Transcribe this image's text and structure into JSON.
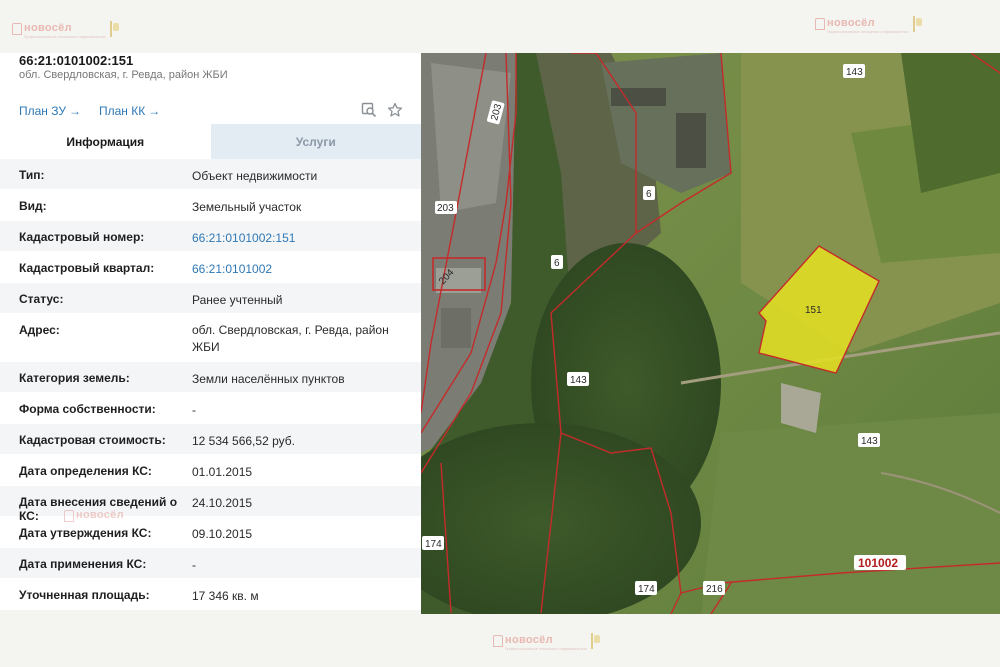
{
  "watermark": {
    "word": "новосёл",
    "sub": "Профессиональные отношения с недвижимостью"
  },
  "object": {
    "title": "66:21:0101002:151",
    "address": "обл. Свердловская, г. Ревда, район ЖБИ"
  },
  "links": {
    "plan_zu": "План ЗУ",
    "plan_kk": "План КК",
    "arrow": "→"
  },
  "tabs": [
    {
      "label": "Информация"
    },
    {
      "label": "Услуги"
    }
  ],
  "rows": [
    {
      "label": "Тип:",
      "value": "Объект недвижимости"
    },
    {
      "label": "Вид:",
      "value": "Земельный участок"
    },
    {
      "label": "Кадастровый номер:",
      "value": "66:21:0101002:151"
    },
    {
      "label": "Кадастровый квартал:",
      "value": "66:21:0101002"
    },
    {
      "label": "Статус:",
      "value": "Ранее учтенный"
    },
    {
      "label": "Адрес:",
      "value": "обл. Свердловская, г. Ревда, район ЖБИ"
    },
    {
      "label": "Категория земель:",
      "value": "Земли населённых пунктов"
    },
    {
      "label": "Форма собственности:",
      "value": "-"
    },
    {
      "label": "Кадастровая стоимость:",
      "value": "12 534 566,52 руб."
    },
    {
      "label": "Дата определения КС:",
      "value": "01.01.2015"
    },
    {
      "label": "Дата внесения сведений о КС:",
      "value": "24.10.2015"
    },
    {
      "label": "Дата утверждения КС:",
      "value": "09.10.2015"
    },
    {
      "label": "Дата применения КС:",
      "value": "-"
    },
    {
      "label": "Уточненная площадь:",
      "value": "17 346 кв. м"
    }
  ],
  "map": {
    "plot_label": "151",
    "quarter_label": "101002",
    "parcel_labels": [
      "143",
      "203",
      "203",
      "6",
      "6",
      "204",
      "143",
      "143",
      "174",
      "174",
      "216"
    ],
    "colors": {
      "plot_fill": "#e6e022",
      "boundary": "#c42b2b"
    }
  },
  "icons": {
    "search": "search-map-icon",
    "star": "star-icon"
  }
}
